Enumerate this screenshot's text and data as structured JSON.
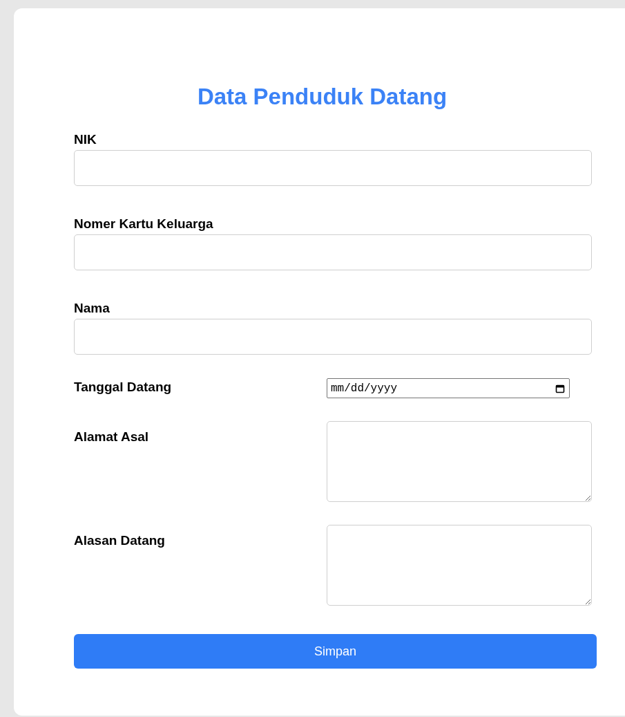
{
  "title": "Data Penduduk Datang",
  "fields": [
    {
      "kind": "text",
      "label": "NIK"
    },
    {
      "kind": "text",
      "label": "Nomer Kartu Keluarga"
    },
    {
      "kind": "text",
      "label": "Nama"
    },
    {
      "kind": "date",
      "label": "Tanggal Datang",
      "placeholder": "mm/dd/yyyy"
    },
    {
      "kind": "textarea",
      "label": "Alamat Asal"
    },
    {
      "kind": "textarea",
      "label": "Alasan Datang"
    }
  ],
  "button": "Simpan"
}
